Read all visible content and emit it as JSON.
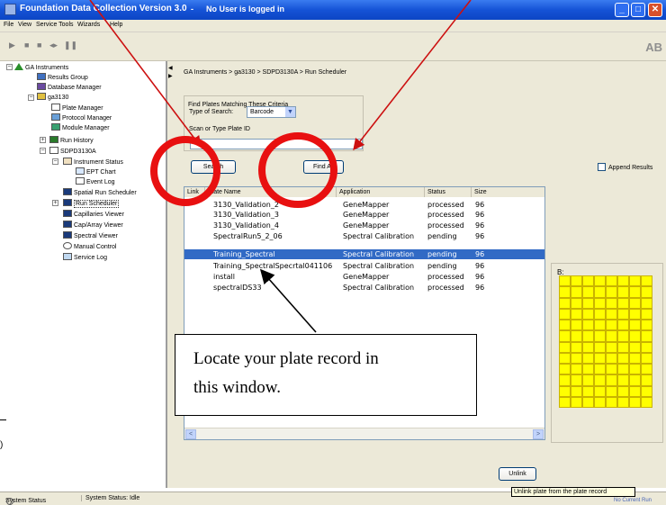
{
  "window": {
    "title": "Foundation Data Collection Version 3.0",
    "separator": "-",
    "subtitle": "No User is logged in",
    "minimize": "_",
    "maximize": "□",
    "close": "✕"
  },
  "menu": [
    "File",
    "View",
    "Service Tools",
    "Wizards",
    "Help"
  ],
  "toolbar": {
    "icons": [
      "play-icon",
      "stop-icon",
      "pause-icon",
      "skip-icon",
      "pause-icon-2"
    ],
    "brand": "AB"
  },
  "tree": [
    {
      "label": "GA Instruments",
      "icon": "triangle-icon"
    },
    {
      "label": "Results Group",
      "icon": "results-group-icon"
    },
    {
      "label": "Database Manager",
      "icon": "database-icon"
    },
    {
      "label": "ga3130",
      "icon": "instrument-icon"
    },
    {
      "label": "Plate Manager",
      "icon": "plate-icon"
    },
    {
      "label": "Protocol Manager",
      "icon": "protocol-icon"
    },
    {
      "label": "Module Manager",
      "icon": "module-icon"
    },
    {
      "label": "Run History",
      "icon": "history-icon"
    },
    {
      "label": "SDPD3130A",
      "icon": "instrument-icon"
    },
    {
      "label": "Instrument Status",
      "icon": "status-icon"
    },
    {
      "label": "EPT Chart",
      "icon": "chart-icon"
    },
    {
      "label": "Event Log",
      "icon": "log-icon"
    },
    {
      "label": "Spatial Run Scheduler",
      "icon": "spatial-icon"
    },
    {
      "label": "Run Scheduler",
      "icon": "scheduler-icon"
    },
    {
      "label": "Capillaries Viewer",
      "icon": "capillary-icon"
    },
    {
      "label": "Cap/Array Viewer",
      "icon": "array-icon"
    },
    {
      "label": "Spectral Viewer",
      "icon": "spectral-icon"
    },
    {
      "label": "Manual Control",
      "icon": "manual-icon"
    },
    {
      "label": "Service Log",
      "icon": "service-icon"
    }
  ],
  "breadcrumb": "GA Instruments > ga3130 > SDPD3130A > Run Scheduler",
  "search_panel": {
    "group_label": "Find Plates Matching These Criteria",
    "type_label": "Type of Search:",
    "type_value": "Barcode",
    "scan_label": "Scan or Type Plate ID",
    "input_value": "",
    "search_button": "Search",
    "find_all_button": "Find All",
    "append_results": "Append Results"
  },
  "table": {
    "columns": [
      "Link",
      "Plate Name",
      "Application",
      "Status",
      "Size"
    ],
    "rows": [
      {
        "link": "",
        "plate_name": "3130_Validation_2",
        "application": "GeneMapper",
        "status": "processed",
        "size": "96"
      },
      {
        "link": "",
        "plate_name": "3130_Validation_3",
        "application": "GeneMapper",
        "status": "processed",
        "size": "96"
      },
      {
        "link": "",
        "plate_name": "3130_Validation_4",
        "application": "GeneMapper",
        "status": "processed",
        "size": "96"
      },
      {
        "link": "",
        "plate_name": "SpectralRun5_2_06",
        "application": "Spectral Calibration",
        "status": "pending",
        "size": "96"
      },
      {
        "link": "",
        "plate_name": "Training_Spectral",
        "application": "Spectral Calibration",
        "status": "pending",
        "size": "96"
      },
      {
        "link": "",
        "plate_name": "Training_SpectralSpecrtal041106",
        "application": "Spectral Calibration",
        "status": "pending",
        "size": "96"
      },
      {
        "link": "",
        "plate_name": "install",
        "application": "GeneMapper",
        "status": "processed",
        "size": "96"
      },
      {
        "link": "",
        "plate_name": "spectralDS33",
        "application": "Spectral Calibration",
        "status": "processed",
        "size": "96"
      }
    ],
    "selected_index": 4
  },
  "plate": {
    "label": "B:",
    "color": "#ffff00"
  },
  "unlink_button": "Unlink",
  "tooltip": "Unlink plate from the plate record",
  "status": {
    "label": "System Status",
    "text": "System Status: Idle",
    "current_run": "No Current Run"
  },
  "callout": {
    "line1": "Locate your plate record in",
    "line2": "this window."
  },
  "left_fragment": ")",
  "annotation_colors": {
    "circle": "#e81010",
    "arrow": "#cc1010"
  }
}
